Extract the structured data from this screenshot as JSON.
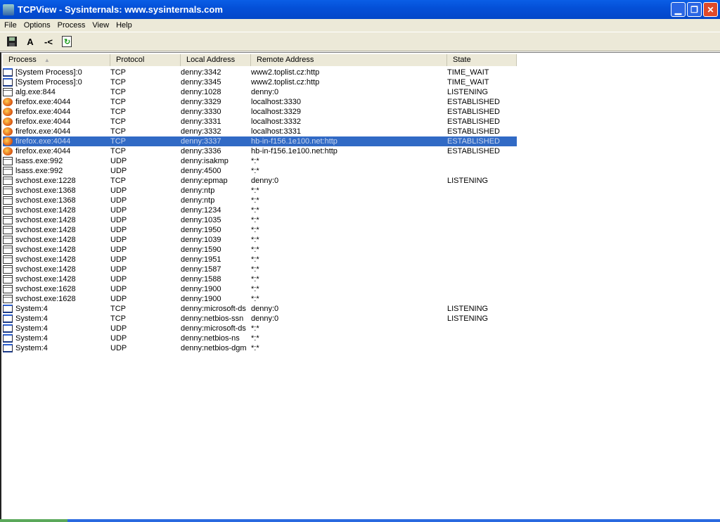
{
  "window": {
    "title": "TCPView - Sysinternals: www.sysinternals.com"
  },
  "menu": [
    "File",
    "Options",
    "Process",
    "View",
    "Help"
  ],
  "toolbar": [
    {
      "icon": "save-icon",
      "label": ""
    },
    {
      "icon": "font-icon",
      "label": "A"
    },
    {
      "icon": "resolve-icon",
      "label": "-<"
    },
    {
      "icon": "refresh-icon",
      "label": ""
    }
  ],
  "columns": [
    "Process",
    "Protocol",
    "Local Address",
    "Remote Address",
    "State"
  ],
  "sort_indicator": "▲",
  "selected_row": 7,
  "rows": [
    [
      "window",
      "[System Process]:0",
      "TCP",
      "denny:3342",
      "www2.toplist.cz:http",
      "TIME_WAIT"
    ],
    [
      "window",
      "[System Process]:0",
      "TCP",
      "denny:3345",
      "www2.toplist.cz:http",
      "TIME_WAIT"
    ],
    [
      "app",
      "alg.exe:844",
      "TCP",
      "denny:1028",
      "denny:0",
      "LISTENING"
    ],
    [
      "firefox",
      "firefox.exe:4044",
      "TCP",
      "denny:3329",
      "localhost:3330",
      "ESTABLISHED"
    ],
    [
      "firefox",
      "firefox.exe:4044",
      "TCP",
      "denny:3330",
      "localhost:3329",
      "ESTABLISHED"
    ],
    [
      "firefox",
      "firefox.exe:4044",
      "TCP",
      "denny:3331",
      "localhost:3332",
      "ESTABLISHED"
    ],
    [
      "firefox",
      "firefox.exe:4044",
      "TCP",
      "denny:3332",
      "localhost:3331",
      "ESTABLISHED"
    ],
    [
      "firefox",
      "firefox.exe:4044",
      "TCP",
      "denny:3337",
      "hb-in-f156.1e100.net:http",
      "ESTABLISHED"
    ],
    [
      "firefox",
      "firefox.exe:4044",
      "TCP",
      "denny:3336",
      "hb-in-f156.1e100.net:http",
      "ESTABLISHED"
    ],
    [
      "app",
      "lsass.exe:992",
      "UDP",
      "denny:isakmp",
      "*:*",
      ""
    ],
    [
      "app",
      "lsass.exe:992",
      "UDP",
      "denny:4500",
      "*:*",
      ""
    ],
    [
      "app",
      "svchost.exe:1228",
      "TCP",
      "denny:epmap",
      "denny:0",
      "LISTENING"
    ],
    [
      "app",
      "svchost.exe:1368",
      "UDP",
      "denny:ntp",
      "*:*",
      ""
    ],
    [
      "app",
      "svchost.exe:1368",
      "UDP",
      "denny:ntp",
      "*:*",
      ""
    ],
    [
      "app",
      "svchost.exe:1428",
      "UDP",
      "denny:1234",
      "*:*",
      ""
    ],
    [
      "app",
      "svchost.exe:1428",
      "UDP",
      "denny:1035",
      "*:*",
      ""
    ],
    [
      "app",
      "svchost.exe:1428",
      "UDP",
      "denny:1950",
      "*:*",
      ""
    ],
    [
      "app",
      "svchost.exe:1428",
      "UDP",
      "denny:1039",
      "*:*",
      ""
    ],
    [
      "app",
      "svchost.exe:1428",
      "UDP",
      "denny:1590",
      "*:*",
      ""
    ],
    [
      "app",
      "svchost.exe:1428",
      "UDP",
      "denny:1951",
      "*:*",
      ""
    ],
    [
      "app",
      "svchost.exe:1428",
      "UDP",
      "denny:1587",
      "*:*",
      ""
    ],
    [
      "app",
      "svchost.exe:1428",
      "UDP",
      "denny:1588",
      "*:*",
      ""
    ],
    [
      "app",
      "svchost.exe:1628",
      "UDP",
      "denny:1900",
      "*:*",
      ""
    ],
    [
      "app",
      "svchost.exe:1628",
      "UDP",
      "denny:1900",
      "*:*",
      ""
    ],
    [
      "window",
      "System:4",
      "TCP",
      "denny:microsoft-ds",
      "denny:0",
      "LISTENING"
    ],
    [
      "window",
      "System:4",
      "TCP",
      "denny:netbios-ssn",
      "denny:0",
      "LISTENING"
    ],
    [
      "window",
      "System:4",
      "UDP",
      "denny:microsoft-ds",
      "*:*",
      ""
    ],
    [
      "window",
      "System:4",
      "UDP",
      "denny:netbios-ns",
      "*:*",
      ""
    ],
    [
      "window",
      "System:4",
      "UDP",
      "denny:netbios-dgm",
      "*:*",
      ""
    ]
  ],
  "colors": {
    "titlebar": "#0450d8",
    "selection": "#316ac5",
    "chrome": "#ece9d8"
  }
}
